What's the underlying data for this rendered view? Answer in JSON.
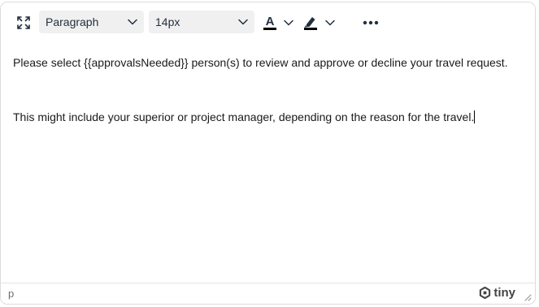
{
  "toolbar": {
    "fullscreen_icon": "fullscreen-icon",
    "block_format": {
      "selected": "Paragraph"
    },
    "font_size": {
      "selected": "14px"
    },
    "text_color_icon": "text-color-icon",
    "highlight_icon": "highlighter-icon",
    "more_icon": "more-ellipsis-icon"
  },
  "content": {
    "paragraphs": [
      "Please select {{approvalsNeeded}} person(s) to review and approve or decline your travel request.",
      "This might include your superior or project manager, depending on the reason for the travel."
    ]
  },
  "statusbar": {
    "path": "p",
    "brand": "tiny"
  },
  "colors": {
    "text_color_indicator": "#000000",
    "highlight_indicator": "#000000",
    "toolbar_select_bg": "#f0f0f0"
  }
}
